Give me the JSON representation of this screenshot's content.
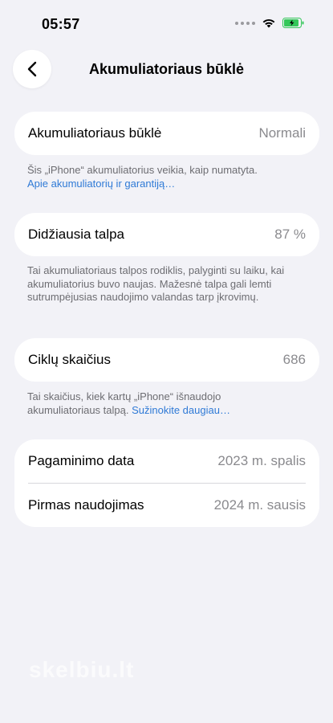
{
  "status_bar": {
    "time": "05:57"
  },
  "nav": {
    "title": "Akumuliatoriaus būklė"
  },
  "battery_health": {
    "label": "Akumuliatoriaus būklė",
    "value": "Normali",
    "note": "Šis „iPhone“ akumuliatorius veikia, kaip numatyta.",
    "link": "Apie akumuliatorių ir garantiją…"
  },
  "max_capacity": {
    "label": "Didžiausia talpa",
    "value": "87 %",
    "note": "Tai akumuliatoriaus talpos rodiklis, palyginti su laiku, kai akumuliatorius buvo naujas. Mažesnė talpa gali lemti sutrumpėjusias naudojimo valandas tarp įkrovimų."
  },
  "cycle_count": {
    "label": "Ciklų skaičius",
    "value": "686",
    "note": "Tai skaičius, kiek kartų „iPhone“ išnaudojo akumuliatoriaus talpą.",
    "link": "Sužinokite daugiau…"
  },
  "dates": {
    "manufacture_label": "Pagaminimo data",
    "manufacture_value": "2023 m. spalis",
    "first_use_label": "Pirmas naudojimas",
    "first_use_value": "2024 m. sausis"
  },
  "watermark": "skelbiu.lt",
  "colors": {
    "background": "#f2f2f7",
    "link": "#2f7ad6",
    "battery": "#34c759"
  }
}
